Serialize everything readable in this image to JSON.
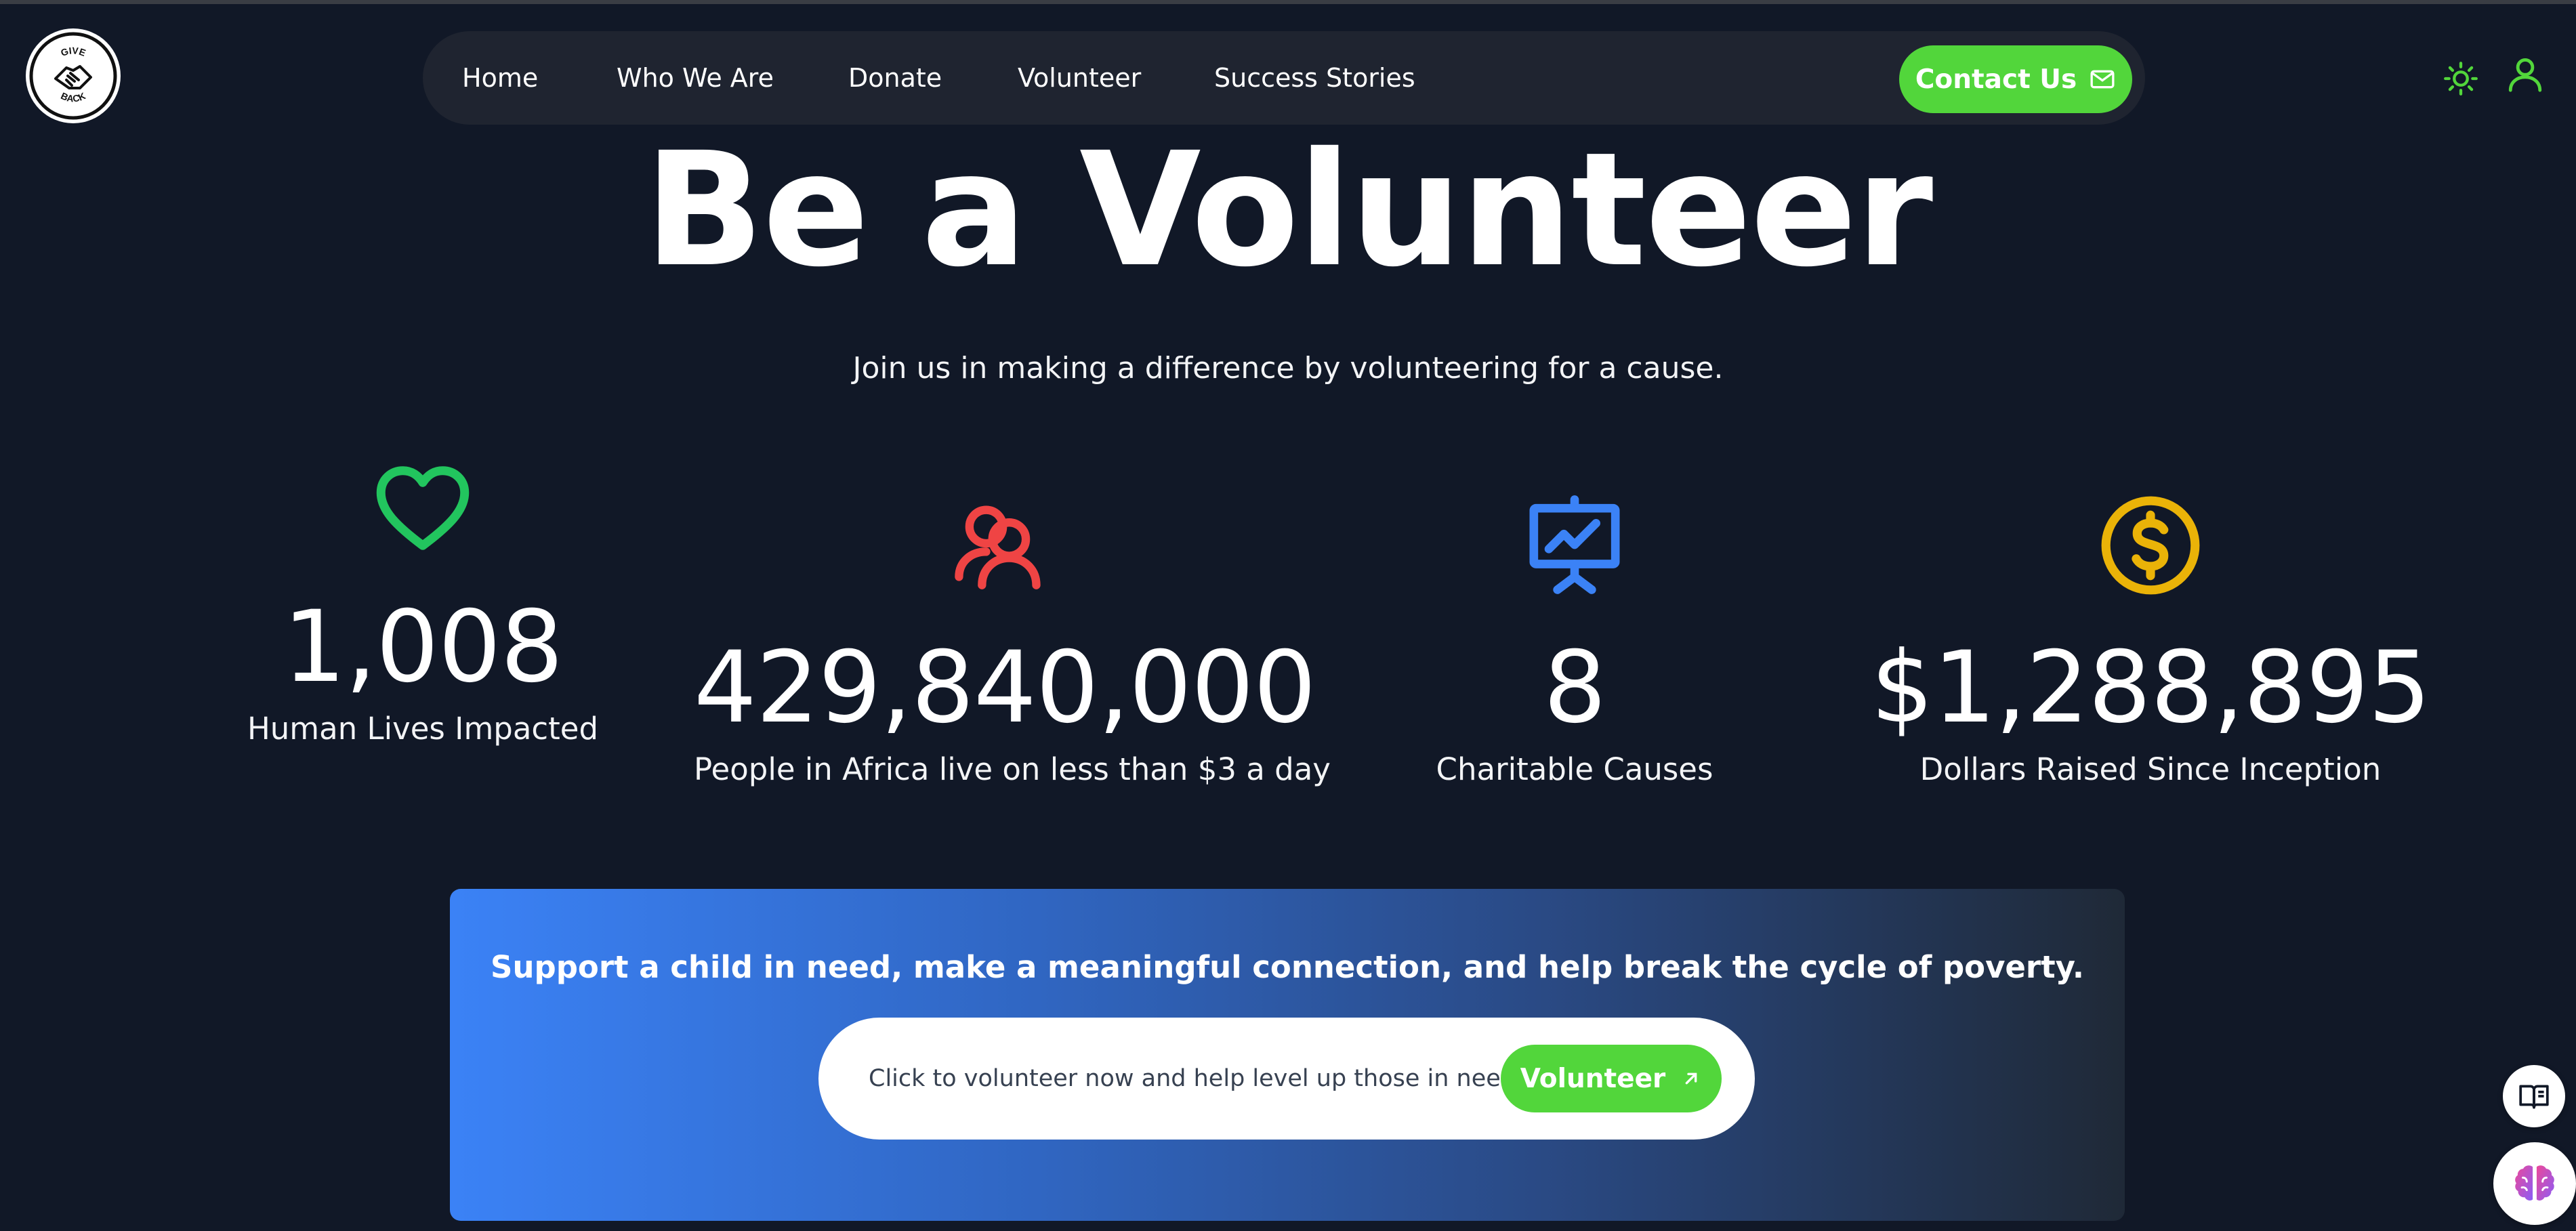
{
  "logo": {
    "text_top": "GIVE",
    "text_bottom": "BACK"
  },
  "nav": {
    "items": [
      {
        "label": "Home"
      },
      {
        "label": "Who We Are"
      },
      {
        "label": "Donate"
      },
      {
        "label": "Volunteer"
      },
      {
        "label": "Success Stories"
      }
    ],
    "contact_label": "Contact Us"
  },
  "hero": {
    "title": "Be a Volunteer",
    "subtitle": "Join us in making a difference by volunteering for a cause."
  },
  "stats": [
    {
      "value": "1,008",
      "label": "Human Lives Impacted",
      "icon": "heart-icon",
      "color": "#22c55e"
    },
    {
      "value": "429,840,000",
      "label": "People in Africa live on less than $3 a day",
      "icon": "users-icon",
      "color": "#ef4444"
    },
    {
      "value": "8",
      "label": "Charitable Causes",
      "icon": "presentation-chart-icon",
      "color": "#3b82f6"
    },
    {
      "value": "$1,288,895",
      "label": "Dollars Raised Since Inception",
      "icon": "dollar-coin-icon",
      "color": "#eab308"
    }
  ],
  "banner": {
    "title": "Support a child in need, make a meaningful connection, and help break the cycle of poverty.",
    "cta_text": "Click to volunteer now and help level up those in need",
    "button_label": "Volunteer"
  },
  "colors": {
    "background": "#111827",
    "accent_green": "#52d63b",
    "nav_bg": "#1f2430"
  },
  "floating": {
    "book_icon": "book-icon",
    "brain_icon": "brain-icon"
  }
}
